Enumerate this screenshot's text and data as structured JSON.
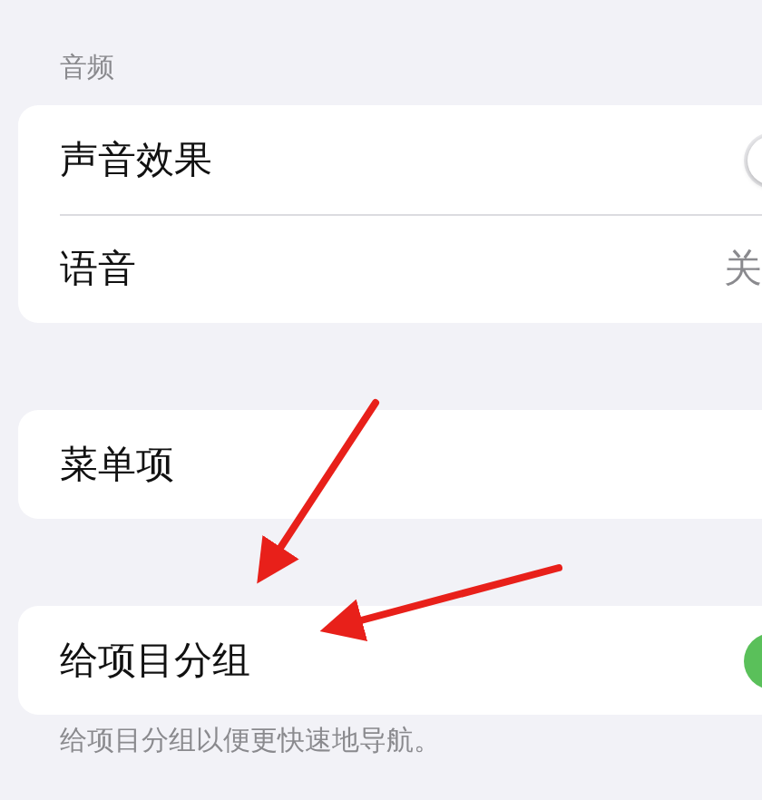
{
  "sections": [
    {
      "header": "音频",
      "rows": [
        {
          "label": "声音效果",
          "kind": "toggle",
          "on": false
        },
        {
          "label": "语音",
          "kind": "value",
          "value": "关"
        }
      ]
    },
    {
      "rows": [
        {
          "label": "菜单项",
          "kind": "plain"
        }
      ]
    },
    {
      "rows": [
        {
          "label": "给项目分组",
          "kind": "toggle",
          "on": true
        }
      ],
      "footer": "给项目分组以便更快速地导航。"
    }
  ]
}
